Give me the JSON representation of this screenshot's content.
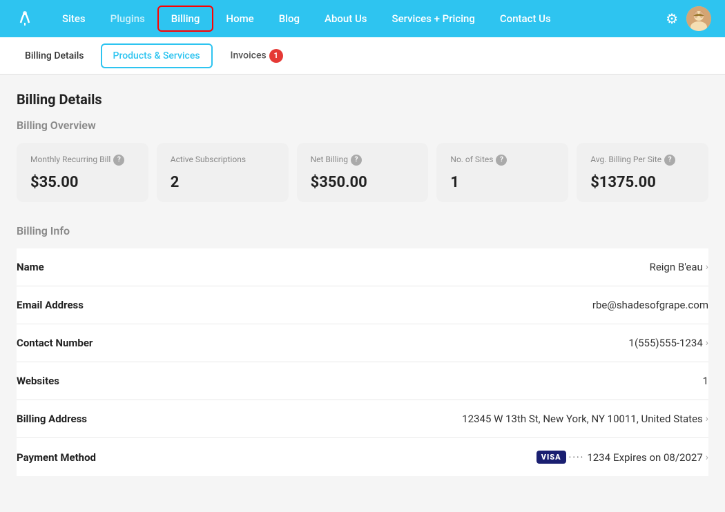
{
  "nav": {
    "links": [
      {
        "label": "Sites",
        "class": "sites"
      },
      {
        "label": "Plugins",
        "class": "plugins"
      },
      {
        "label": "Billing",
        "class": "active"
      },
      {
        "label": "Home",
        "class": ""
      },
      {
        "label": "Blog",
        "class": ""
      },
      {
        "label": "About Us",
        "class": ""
      },
      {
        "label": "Services + Pricing",
        "class": ""
      },
      {
        "label": "Contact Us",
        "class": ""
      }
    ]
  },
  "subnav": {
    "items": [
      {
        "label": "Billing Details",
        "class": ""
      },
      {
        "label": "Products & Services",
        "class": "active"
      },
      {
        "label": "Invoices",
        "class": "",
        "badge": "1"
      }
    ]
  },
  "billing_details": {
    "title": "Billing Details",
    "overview_title": "Billing Overview",
    "cards": [
      {
        "label": "Monthly Recurring Bill",
        "value": "$35.00",
        "has_help": true
      },
      {
        "label": "Active Subscriptions",
        "value": "2",
        "has_help": false
      },
      {
        "label": "Net Billing",
        "value": "$350.00",
        "has_help": true
      },
      {
        "label": "No. of Sites",
        "value": "1",
        "has_help": true
      },
      {
        "label": "Avg. Billing Per Site",
        "value": "$1375.00",
        "has_help": true
      }
    ],
    "info_title": "Billing Info",
    "info_rows": [
      {
        "label": "Name",
        "value": "Reign B'eau",
        "has_chevron": true
      },
      {
        "label": "Email Address",
        "value": "rbe@shadesofgrape.com",
        "has_chevron": false
      },
      {
        "label": "Contact Number",
        "value": "1(555)555-1234",
        "has_chevron": true
      },
      {
        "label": "Websites",
        "value": "1",
        "has_chevron": false
      },
      {
        "label": "Billing Address",
        "value": "12345 W 13th St, New York, NY 10011, United States",
        "has_chevron": true
      },
      {
        "label": "Payment Method",
        "value": "",
        "has_chevron": true,
        "is_payment": true
      }
    ],
    "payment": {
      "visa_label": "VISA",
      "dots": "····",
      "last4": "1234",
      "expires": "Expires on  08/2027"
    }
  }
}
